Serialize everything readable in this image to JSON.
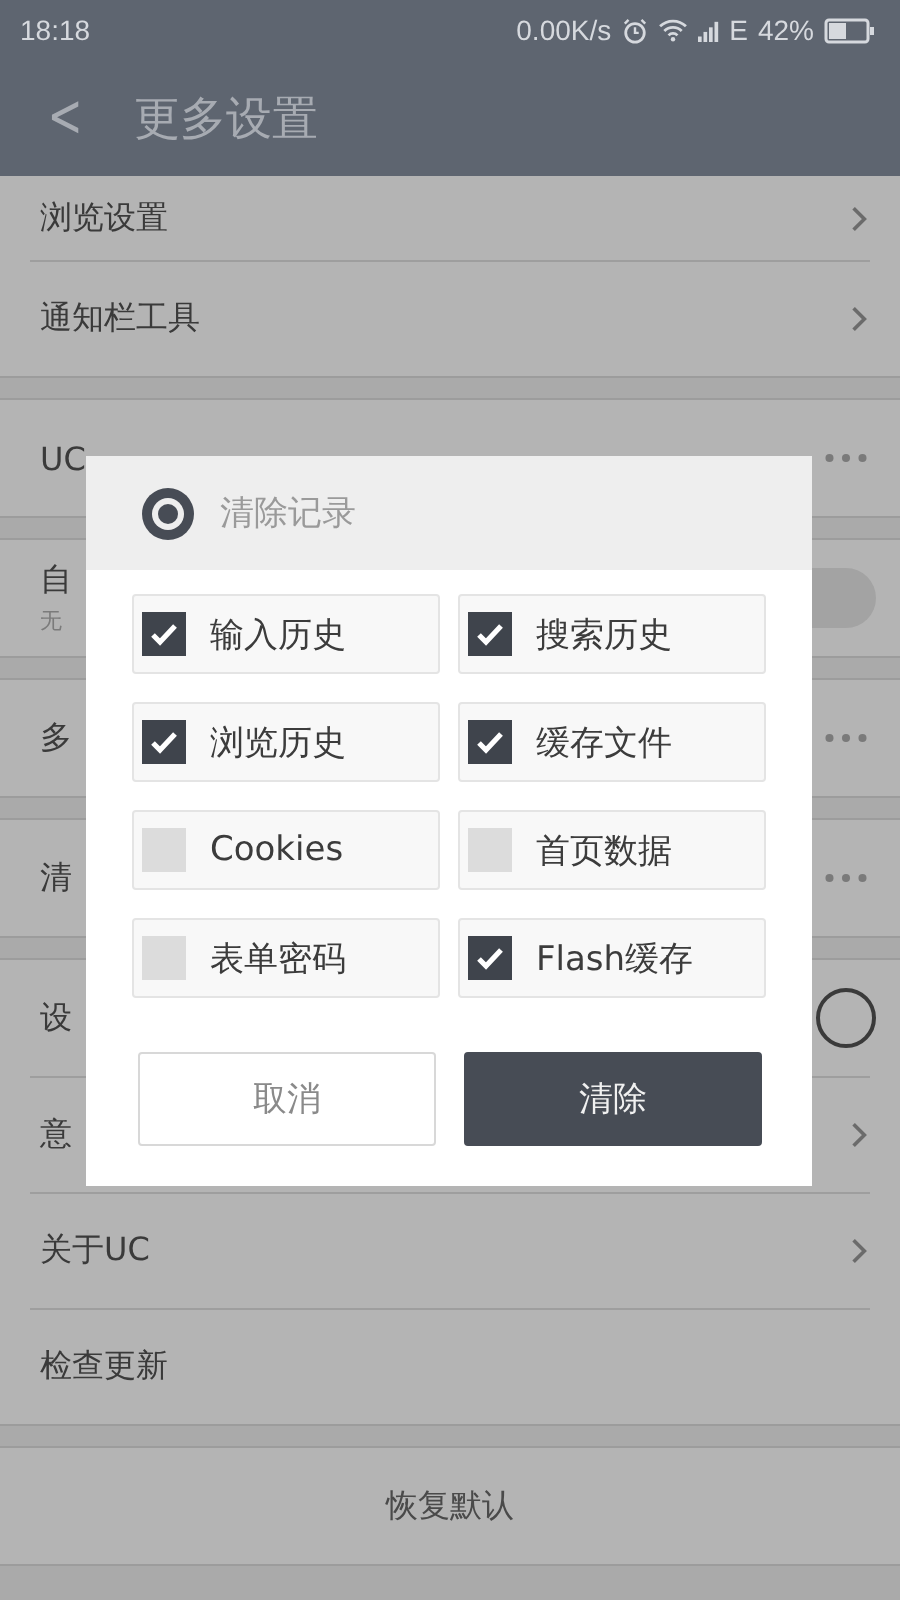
{
  "status_bar": {
    "time": "18:18",
    "speed": "0.00K/s",
    "network": "E",
    "battery": "42%"
  },
  "header": {
    "back": "<",
    "title": "更多设置"
  },
  "sections": [
    [
      {
        "title": "浏览设置",
        "kind": "chevron"
      },
      {
        "title": "通知栏工具",
        "kind": "chevron"
      }
    ],
    [
      {
        "title": "UC",
        "kind": "dots"
      }
    ],
    [
      {
        "title": "自",
        "subtitle": "无",
        "kind": "switch",
        "on": false
      }
    ],
    [
      {
        "title": "多",
        "kind": "dots"
      }
    ],
    [
      {
        "title": "清",
        "kind": "dots"
      }
    ],
    [
      {
        "title": "设",
        "kind": "radio",
        "on": false
      },
      {
        "title": "意",
        "kind": "chevron"
      },
      {
        "title": "关于UC",
        "kind": "chevron"
      },
      {
        "title": "检查更新",
        "kind": "plain"
      }
    ]
  ],
  "reset_button": "恢复默认",
  "dialog": {
    "title": "清除记录",
    "options": [
      {
        "label": "输入历史",
        "checked": true
      },
      {
        "label": "搜索历史",
        "checked": true
      },
      {
        "label": "浏览历史",
        "checked": true
      },
      {
        "label": "缓存文件",
        "checked": true
      },
      {
        "label": "Cookies",
        "checked": false
      },
      {
        "label": "首页数据",
        "checked": false
      },
      {
        "label": "表单密码",
        "checked": false
      },
      {
        "label": "Flash缓存",
        "checked": true
      }
    ],
    "buttons": [
      {
        "label": "取消",
        "kind": "secondary"
      },
      {
        "label": "清除",
        "kind": "primary"
      }
    ]
  }
}
